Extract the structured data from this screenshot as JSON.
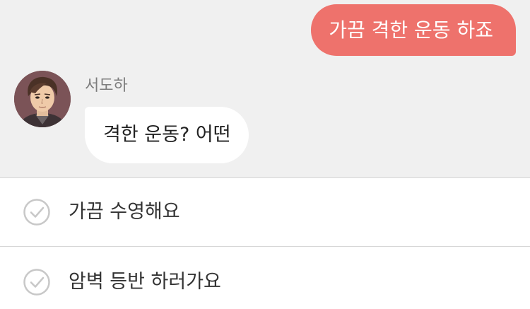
{
  "chat": {
    "outgoing_message": "가끔 격한 운동 하죠",
    "sender": {
      "name": "서도하",
      "avatar_icon": "character-portrait-avatar"
    },
    "incoming_message": "격한 운동? 어떤"
  },
  "choices": [
    {
      "label": "가끔 수영해요",
      "icon": "check-circle-icon"
    },
    {
      "label": "암벽 등반 하러가요",
      "icon": "check-circle-icon"
    }
  ],
  "colors": {
    "outgoing_bubble": "#ee726c",
    "chat_background": "#f0f0f0",
    "incoming_bubble": "#ffffff",
    "check_icon": "#c8c8c8"
  }
}
